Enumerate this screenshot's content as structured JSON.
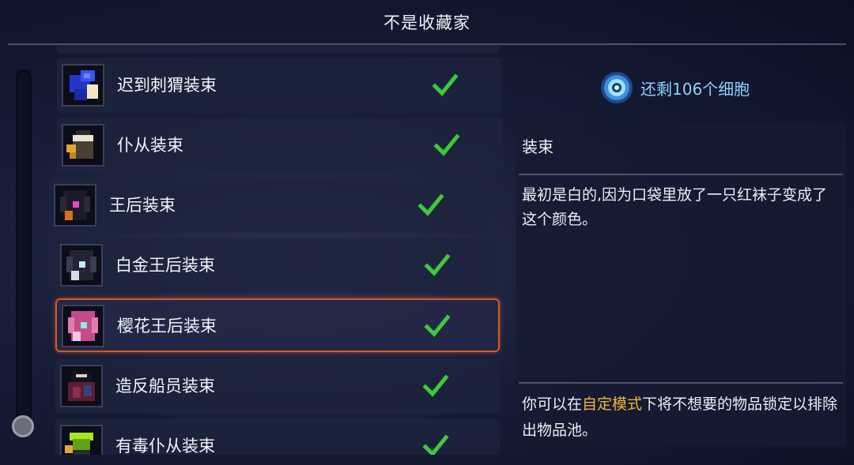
{
  "header": {
    "title": "不是收藏家"
  },
  "outfits": [
    {
      "name": "迟到刺猬装束",
      "unlocked": true,
      "selected": false,
      "icon": "hedgehog-outfit-icon"
    },
    {
      "name": "仆从装束",
      "unlocked": true,
      "selected": false,
      "icon": "servant-outfit-icon"
    },
    {
      "name": "王后装束",
      "unlocked": true,
      "selected": false,
      "icon": "queen-outfit-icon"
    },
    {
      "name": "白金王后装束",
      "unlocked": true,
      "selected": false,
      "icon": "platinum-queen-outfit-icon"
    },
    {
      "name": "樱花王后装束",
      "unlocked": true,
      "selected": true,
      "icon": "sakura-queen-outfit-icon"
    },
    {
      "name": "造反船员装束",
      "unlocked": true,
      "selected": false,
      "icon": "mutineer-outfit-icon"
    },
    {
      "name": "有毒仆从装束",
      "unlocked": true,
      "selected": false,
      "icon": "toxic-servant-outfit-icon"
    }
  ],
  "cells": {
    "text": "还剩106个细胞",
    "icon": "cell-icon"
  },
  "details": {
    "category": "装束",
    "description": "最初是白的,因为口袋里放了一只红袜子变成了这个颜色。",
    "note_prefix": "你可以在",
    "note_highlight": "自定模式",
    "note_suffix": "下将不想要的物品锁定以排除出物品池。"
  },
  "colors": {
    "check": "#3fc93a",
    "highlight": "#f0b53a",
    "selected_border": "#d35a2a",
    "cells_text": "#8fd3ff"
  }
}
